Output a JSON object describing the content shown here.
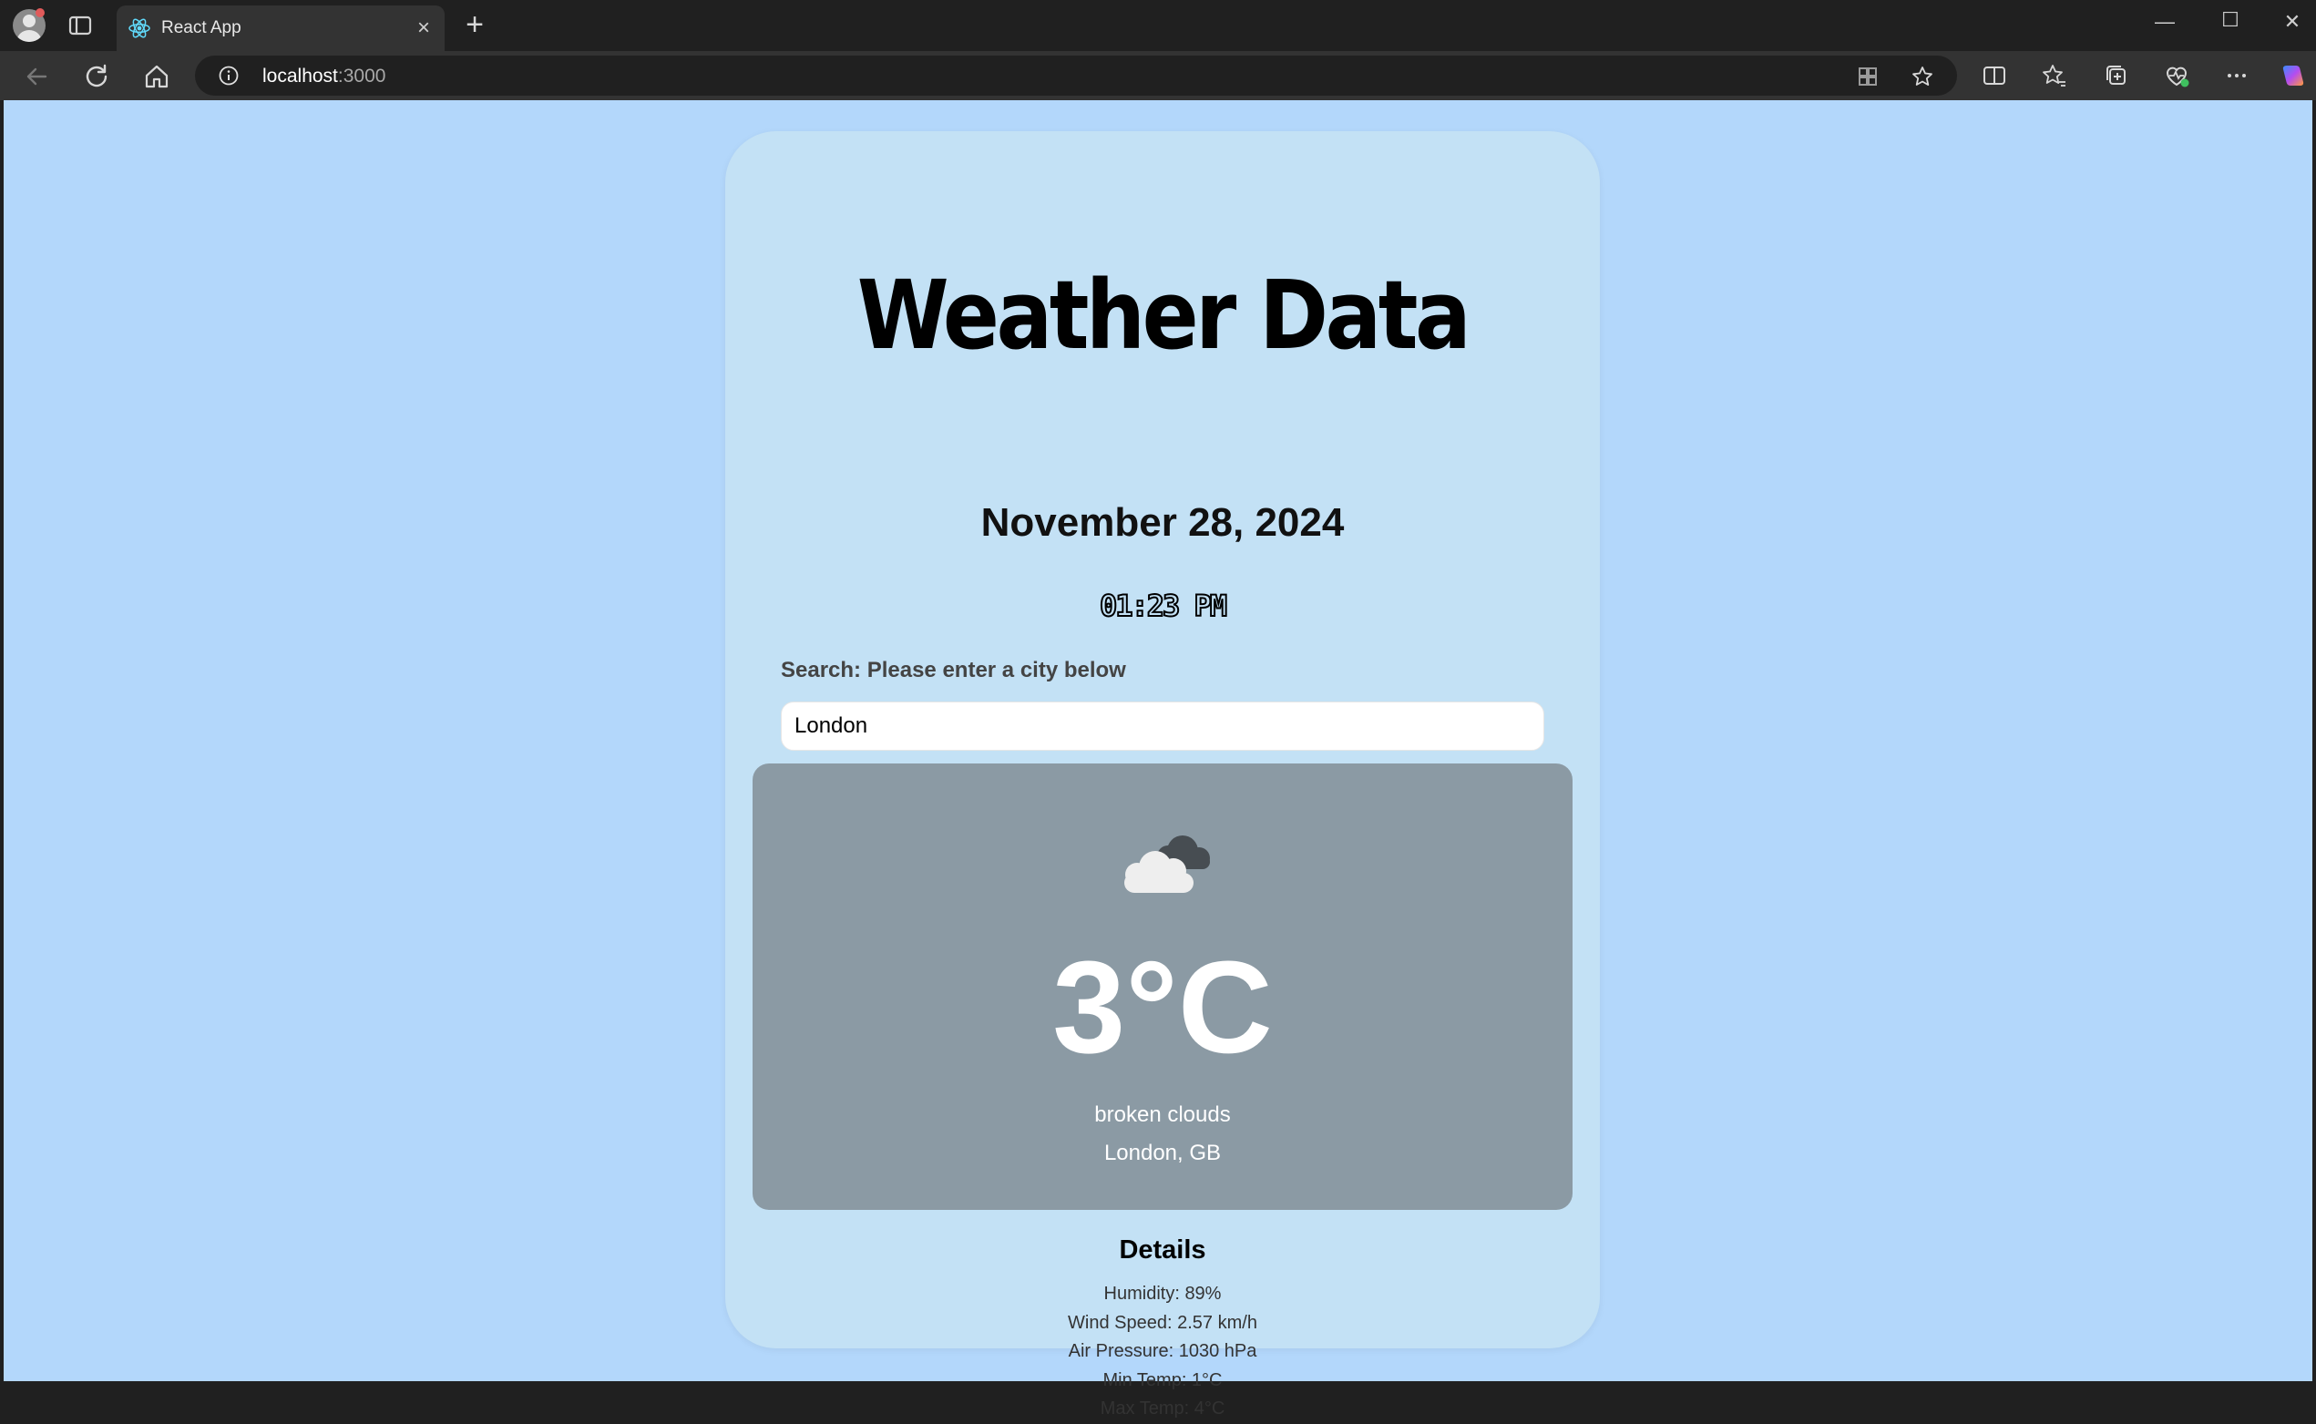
{
  "browser": {
    "tab_title": "React App",
    "url_host": "localhost",
    "url_port": ":3000"
  },
  "app": {
    "title": "Weather Data",
    "date": "November 28, 2024",
    "time": "01:23 PM",
    "search_label": "Search: Please enter a city below",
    "search_value": "London",
    "weather": {
      "icon": "broken-clouds-icon",
      "temperature": "3°C",
      "description": "broken clouds",
      "location": "London, GB"
    },
    "details": {
      "heading": "Details",
      "items": [
        "Humidity: 89%",
        "Wind Speed: 2.57 km/h",
        "Air Pressure: 1030 hPa",
        "Min Temp: 1°C",
        "Max Temp: 4°C"
      ]
    }
  },
  "colors": {
    "page_background": "#b3d7fb",
    "card_background": "#c3e1f5",
    "weather_panel": "#8b9aa4"
  }
}
